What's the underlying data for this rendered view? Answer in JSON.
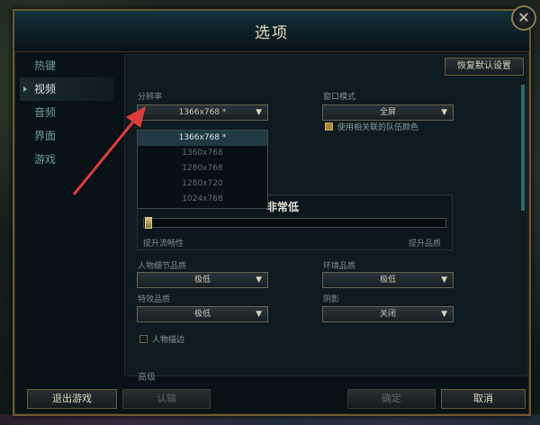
{
  "dialog": {
    "title": "选项",
    "close_glyph": "✕",
    "reset_label": "恢复默认设置"
  },
  "sidebar": {
    "items": [
      {
        "label": "热键"
      },
      {
        "label": "视频"
      },
      {
        "label": "音频"
      },
      {
        "label": "界面"
      },
      {
        "label": "游戏"
      }
    ],
    "active_index": 1
  },
  "video": {
    "resolution_label": "分辨率",
    "resolution_value": "1366x768 *",
    "resolution_options": [
      "1366x768 *",
      "1360x768",
      "1280x768",
      "1280x720",
      "1024x768"
    ],
    "window_mode_label": "窗口模式",
    "window_mode_value": "全屏",
    "color_checkbox_label": "使用相关联的队伍颜色",
    "quality_title": "非常低",
    "quality_level": 0.0,
    "slider_left_label": "提升流畅性",
    "slider_right_label": "提升品质",
    "character_quality_label": "人物细节品质",
    "character_quality_value": "极低",
    "env_quality_label": "环境品质",
    "env_quality_value": "极低",
    "effects_quality_label": "特效品质",
    "effects_quality_value": "极低",
    "shadow_label": "阴影",
    "shadow_value": "关闭",
    "outline_checkbox_label": "人物描边",
    "advanced_label": "高级"
  },
  "footer": {
    "exit_label": "退出游戏",
    "confirm_left_label": "认输",
    "ok_label": "确定",
    "cancel_label": "取消"
  },
  "colors": {
    "accent_gold": "#6d5a34",
    "annotation_arrow": "#e23b3b"
  }
}
